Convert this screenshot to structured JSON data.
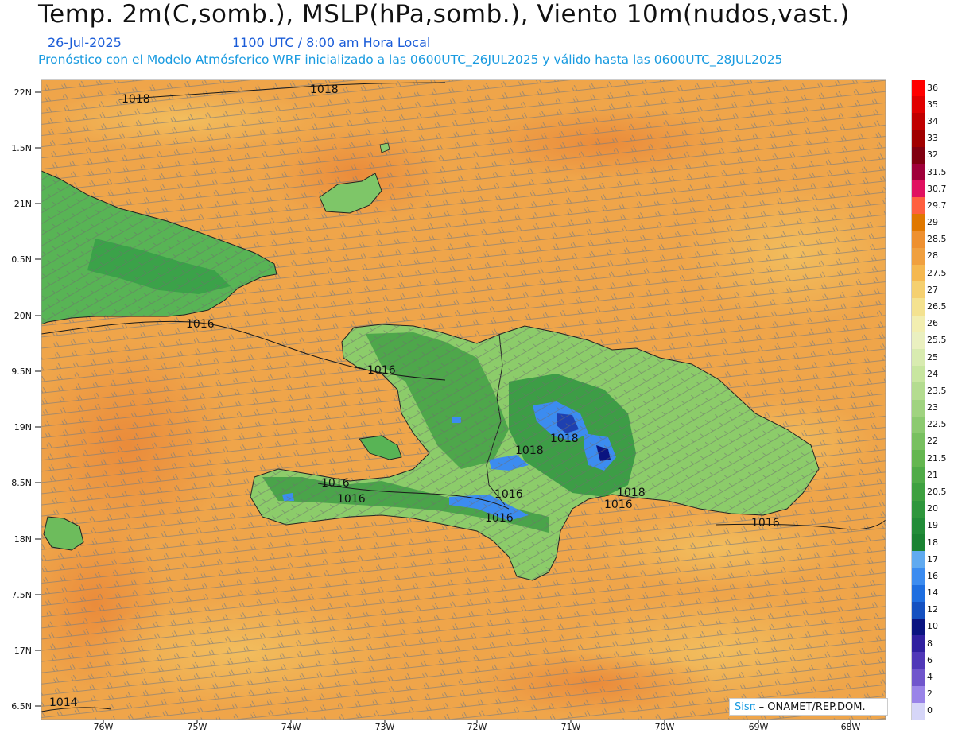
{
  "header": {
    "title": "Temp. 2m(C,somb.), MSLP(hPa,somb.), Viento 10m(nudos,vast.)",
    "date": "26-Jul-2025",
    "time": "1100 UTC / 8:00 am Hora Local",
    "forecast": "Pronóstico con el Modelo Atmósferico WRF inicializado a las 0600UTC_26JUL2025 y válido hasta las  0600UTC_28JUL2025"
  },
  "map": {
    "lat_labels": [
      "22N",
      "1.5N",
      "21N",
      "0.5N",
      "20N",
      "9.5N",
      "19N",
      "8.5N",
      "18N",
      "7.5N",
      "17N",
      "6.5N"
    ],
    "lon_labels": [
      "76W",
      "75W",
      "74W",
      "73W",
      "72W",
      "71W",
      "70W",
      "69W",
      "68W"
    ],
    "isobar_labels": [
      "1018",
      "1018",
      "1016",
      "1016",
      "1018",
      "1018",
      "1016",
      "1016",
      "1016",
      "1016",
      "1018",
      "1016",
      "1016",
      "1014"
    ]
  },
  "legend": {
    "labels": [
      "36",
      "35",
      "34",
      "33",
      "32",
      "31.5",
      "30.7",
      "29.7",
      "29",
      "28.5",
      "28",
      "27.5",
      "27",
      "26.5",
      "26",
      "25.5",
      "25",
      "24",
      "23.5",
      "23",
      "22.5",
      "22",
      "21.5",
      "21",
      "20.5",
      "20",
      "19",
      "18",
      "17",
      "16",
      "14",
      "12",
      "10",
      "8",
      "6",
      "4",
      "2",
      "0"
    ],
    "colors": [
      "#ff0000",
      "#e00000",
      "#c00000",
      "#a00000",
      "#800010",
      "#a0003a",
      "#e01060",
      "#ff6040",
      "#e07800",
      "#ee9030",
      "#f0a040",
      "#f5b850",
      "#f5d070",
      "#f4e290",
      "#f2eeb0",
      "#eaf0c0",
      "#d8ebb0",
      "#c8e6a0",
      "#b4dc90",
      "#a0d380",
      "#8cca70",
      "#78c060",
      "#64b650",
      "#50ab48",
      "#3ea040",
      "#2e963c",
      "#228c38",
      "#1a8232",
      "#60aaf0",
      "#3c8cf0",
      "#1e6ee0",
      "#1450c0",
      "#0a1480",
      "#3020a0",
      "#5038b8",
      "#7056cc",
      "#9a84e8",
      "#d6d6f8"
    ]
  },
  "credit": {
    "brand": "Sisπ",
    "text": " – ONAMET/REP.DOM."
  }
}
